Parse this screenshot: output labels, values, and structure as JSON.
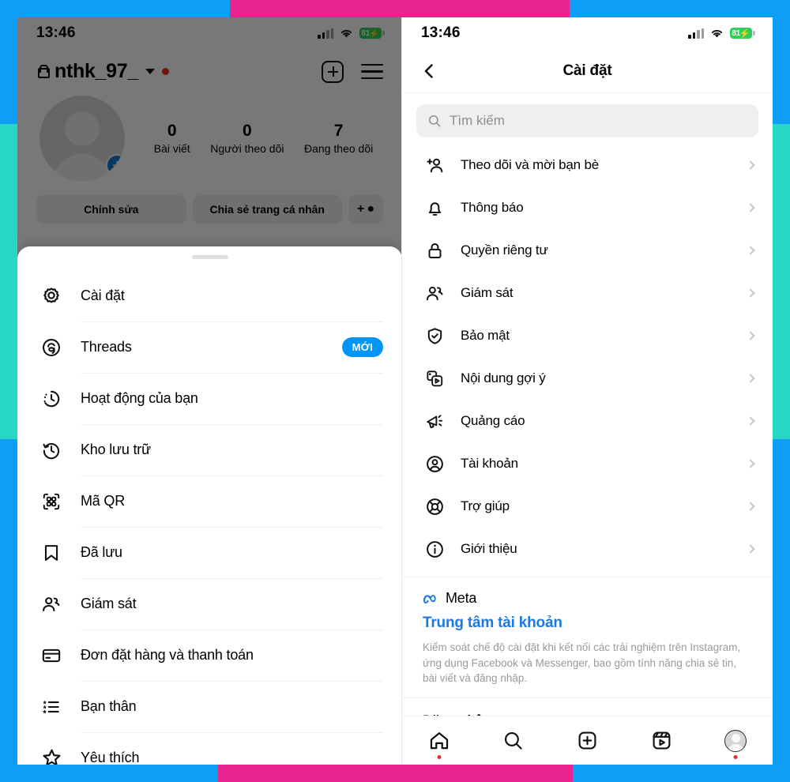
{
  "frame": {
    "blue": "#0e9ef5",
    "pink": "#e8238f",
    "teal": "#27d7c4"
  },
  "status_bar": {
    "time": "13:46",
    "battery_percent": "81",
    "charging": true,
    "signal_icon": "cellular-signal-icon",
    "wifi_icon": "wifi-icon",
    "battery_icon": "battery-icon"
  },
  "left_screen": {
    "profile": {
      "username": "nthk_97_",
      "private_icon": "lock-icon",
      "chevron_icon": "chevron-down-icon",
      "new_dot": true,
      "create_icon": "plus-square-icon",
      "menu_icon": "hamburger-menu-icon",
      "avatar_add_icon": "add-story-plus-icon",
      "stats": [
        {
          "value": "0",
          "label": "Bài viết"
        },
        {
          "value": "0",
          "label": "Người theo dõi"
        },
        {
          "value": "7",
          "label": "Đang theo dõi"
        }
      ],
      "buttons": [
        {
          "label": "Chỉnh sửa"
        },
        {
          "label": "Chia sẻ trang cá nhân"
        },
        {
          "label": "+ ●"
        }
      ]
    },
    "sheet": {
      "grabber": "drag-handle",
      "items": [
        {
          "label": "Cài đặt",
          "icon": "gear-icon",
          "badge": ""
        },
        {
          "label": "Threads",
          "icon": "threads-icon",
          "badge": "MỚI"
        },
        {
          "label": "Hoạt động của bạn",
          "icon": "activity-clock-icon",
          "badge": ""
        },
        {
          "label": "Kho lưu trữ",
          "icon": "archive-clock-icon",
          "badge": ""
        },
        {
          "label": "Mã QR",
          "icon": "qr-code-icon",
          "badge": ""
        },
        {
          "label": "Đã lưu",
          "icon": "bookmark-icon",
          "badge": ""
        },
        {
          "label": "Giám sát",
          "icon": "supervision-people-icon",
          "badge": ""
        },
        {
          "label": "Đơn đặt hàng và thanh toán",
          "icon": "credit-card-icon",
          "badge": ""
        },
        {
          "label": "Bạn thân",
          "icon": "close-friends-list-icon",
          "badge": ""
        },
        {
          "label": "Yêu thích",
          "icon": "star-icon",
          "badge": ""
        }
      ]
    }
  },
  "right_screen": {
    "nav": {
      "back_icon": "chevron-left-icon",
      "title": "Cài đặt"
    },
    "search": {
      "placeholder": "Tìm kiếm",
      "icon": "search-icon",
      "value": ""
    },
    "items": [
      {
        "label": "Theo dõi và mời bạn bè",
        "icon": "person-add-icon"
      },
      {
        "label": "Thông báo",
        "icon": "bell-icon"
      },
      {
        "label": "Quyền riêng tư",
        "icon": "lock-icon"
      },
      {
        "label": "Giám sát",
        "icon": "supervision-people-icon"
      },
      {
        "label": "Bảo mật",
        "icon": "shield-check-icon"
      },
      {
        "label": "Nội dung gợi ý",
        "icon": "suggested-content-icon"
      },
      {
        "label": "Quảng cáo",
        "icon": "megaphone-icon"
      },
      {
        "label": "Tài khoản",
        "icon": "account-circle-icon"
      },
      {
        "label": "Trợ giúp",
        "icon": "lifebuoy-help-icon"
      },
      {
        "label": "Giới thiệu",
        "icon": "info-circle-icon"
      }
    ],
    "meta": {
      "brand": "Meta",
      "brand_icon": "meta-infinity-icon",
      "link": "Trung tâm tài khoản",
      "link_color": "#1a7ae0",
      "description": "Kiểm soát chế độ cài đặt khi kết nối các trải nghiệm trên Instagram, ứng dụng Facebook và Messenger, bao gồm tính năng chia sẻ tin, bài viết và đăng nhập."
    },
    "login_section": {
      "title": "Đăng nhập"
    },
    "tabbar": [
      {
        "icon": "home-icon",
        "name": "tab-home",
        "dot": true
      },
      {
        "icon": "search-icon",
        "name": "tab-search",
        "dot": false
      },
      {
        "icon": "plus-square-icon",
        "name": "tab-create",
        "dot": false
      },
      {
        "icon": "reels-icon",
        "name": "tab-reels",
        "dot": false
      },
      {
        "icon": "avatar-icon",
        "name": "tab-profile",
        "dot": true
      }
    ]
  }
}
